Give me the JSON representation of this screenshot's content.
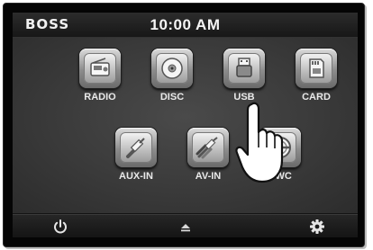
{
  "header": {
    "brand": "BOSS",
    "time": "10:00 AM"
  },
  "menu": {
    "row1": [
      {
        "label": "RADIO",
        "icon": "radio-icon"
      },
      {
        "label": "DISC",
        "icon": "disc-icon"
      },
      {
        "label": "USB",
        "icon": "usb-icon"
      },
      {
        "label": "CARD",
        "icon": "sd-card-icon"
      }
    ],
    "row2": [
      {
        "label": "AUX-IN",
        "icon": "aux-cable-icon"
      },
      {
        "label": "AV-IN",
        "icon": "av-cable-icon"
      },
      {
        "label": "SWC",
        "icon": "steering-wheel-icon"
      }
    ]
  },
  "footer": {
    "power_icon": "power-icon",
    "eject_icon": "eject-icon",
    "settings_icon": "gear-icon"
  },
  "colors": {
    "background": "#141414",
    "text": "#f1f1f1",
    "icon_frame": "#9a9a9a"
  }
}
